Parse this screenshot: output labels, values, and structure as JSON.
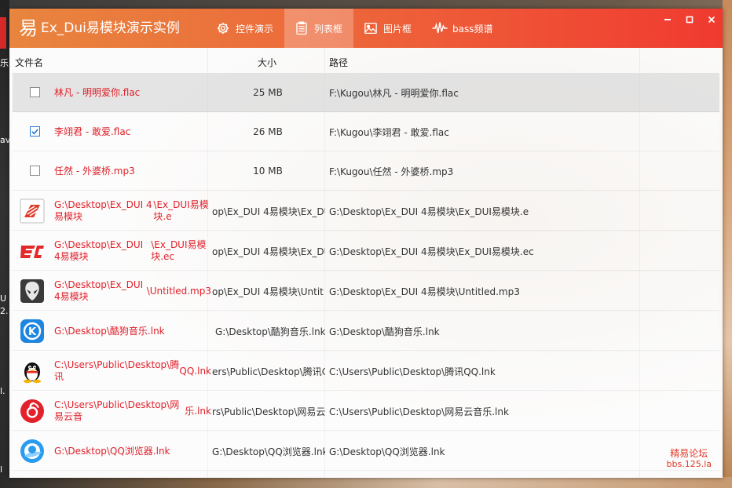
{
  "desktop": {
    "fragments": [
      "乐",
      "av",
      "U",
      "2.",
      "l.",
      "l"
    ]
  },
  "window": {
    "title": "Ex_Dui易模块演示实例",
    "logo_glyph": "易",
    "tabs": [
      {
        "label": "控件演示",
        "icon": "gear-icon",
        "active": false
      },
      {
        "label": "列表框",
        "icon": "list-icon",
        "active": true
      },
      {
        "label": "图片框",
        "icon": "image-icon",
        "active": false
      },
      {
        "label": "bass频谱",
        "icon": "waveform-icon",
        "active": false
      }
    ],
    "controls": {
      "minimize": "▬",
      "maximize": "□",
      "close": "✕"
    }
  },
  "list": {
    "columns": {
      "name": "文件名",
      "size": "大小",
      "path": "路径"
    },
    "rows": [
      {
        "name": "林凡 - 明明爱你.flac",
        "size": "25 MB",
        "path": "F:\\Kugou\\林凡 - 明明爱你.flac",
        "checkbox": true,
        "checked": false,
        "selected": true
      },
      {
        "name": "李翊君 - 敢爱.flac",
        "size": "26 MB",
        "path": "F:\\Kugou\\李翊君 - 敢爱.flac",
        "checkbox": true,
        "checked": true
      },
      {
        "name": "任然 - 外婆桥.mp3",
        "size": "10 MB",
        "path": "F:\\Kugou\\任然 - 外婆桥.mp3",
        "checkbox": true,
        "checked": false
      },
      {
        "name1": "G:\\Desktop\\Ex_DUI 4易模块",
        "name2": "\\Ex_DUI易模块.e",
        "size": "op\\Ex_DUI 4易模块\\Ex_DU",
        "path": "G:\\Desktop\\Ex_DUI 4易模块\\Ex_DUI易模块.e",
        "icon": "e-file-icon"
      },
      {
        "name1": "G:\\Desktop\\Ex_DUI 4易模块",
        "name2": "\\Ex_DUI易模块.ec",
        "size": "op\\Ex_DUI 4易模块\\Ex_DU",
        "path": "G:\\Desktop\\Ex_DUI 4易模块\\Ex_DUI易模块.ec",
        "icon": "ec-file-icon"
      },
      {
        "name1": "G:\\Desktop\\Ex_DUI 4易模块",
        "name2": "\\Untitled.mp3",
        "size": "op\\Ex_DUI 4易模块\\Untit",
        "path": "G:\\Desktop\\Ex_DUI 4易模块\\Untitled.mp3",
        "icon": "alien-media-icon"
      },
      {
        "name1": "G:\\Desktop\\酷狗音乐.lnk",
        "name2": "",
        "size": "G:\\Desktop\\酷狗音乐.lnk",
        "path": "G:\\Desktop\\酷狗音乐.lnk",
        "icon": "kugou-icon"
      },
      {
        "name1": "C:\\Users\\Public\\Desktop\\腾讯",
        "name2": "QQ.lnk",
        "size": "ers\\Public\\Desktop\\腾讯C",
        "path": "C:\\Users\\Public\\Desktop\\腾讯QQ.lnk",
        "icon": "qq-penguin-icon"
      },
      {
        "name1": "C:\\Users\\Public\\Desktop\\网易云音",
        "name2": "乐.lnk",
        "size": "rs\\Public\\Desktop\\网易云音",
        "path": "C:\\Users\\Public\\Desktop\\网易云音乐.lnk",
        "icon": "netease-music-icon"
      },
      {
        "name1": "G:\\Desktop\\QQ浏览器.lnk",
        "name2": "",
        "size": "G:\\Desktop\\QQ浏览器.lnk",
        "path": "G:\\Desktop\\QQ浏览器.lnk",
        "icon": "qq-browser-icon"
      }
    ]
  },
  "watermark": {
    "line1": "精易论坛",
    "line2": "bbs.125.la"
  },
  "colors": {
    "accent_start": "#e8853e",
    "accent_end": "#f03a30",
    "name_text": "#e0202a",
    "check": "#2a7ad6"
  }
}
